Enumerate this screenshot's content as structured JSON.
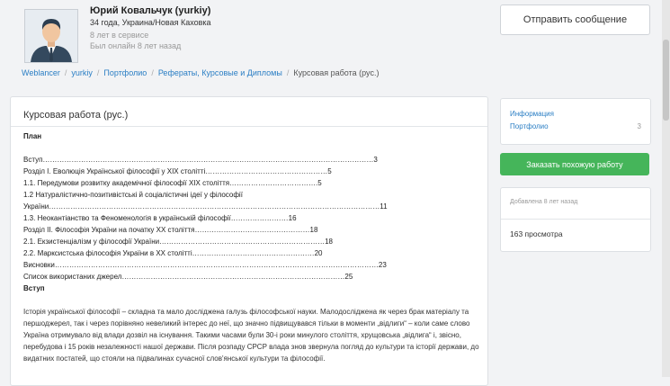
{
  "profile": {
    "name": "Юрий Ковальчук (yurkiy)",
    "info": "34 года, Украина/Новая Каховка",
    "service": "8 лет в сервисе",
    "online": "Был онлайн 8 лет назад"
  },
  "header": {
    "message_button": "Отправить сообщение"
  },
  "breadcrumb": {
    "items": [
      "Weblancer",
      "yurkiy",
      "Портфолио",
      "Рефераты, Курсовые и Дипломы"
    ],
    "current": "Курсовая работа (рус.)"
  },
  "main": {
    "title": "Курсовая работа (рус.)",
    "plan_heading": "План",
    "toc": [
      "Вступ…………………………………………………………………………………………………………………………3",
      "Розділ І. Еволюція Української філософії у ХІХ столітті……………………………………………5",
      "1.1. Передумови розвитку академічної філософії ХІХ століття……………………………….5",
      "1.2 Натуралістично-позитивістські й соціалістичні ідеї у філософії",
      "України…………………………………………………………………………………………………………………………11",
      "1.3. Неокантіанство та Феноменологія в українській філософії……………………16",
      "Розділ ІІ. Філософія України на початку ХХ століття…………………………………………18",
      "2.1. Екзистенціалізм у філософії України……………………………………………………………18",
      "2.2. Марксистська філософія України в ХХ столітті……………………………………………20",
      "Висновки………………………………………………………………………………………………………………………23",
      "Список використаних джерел…………………………………………………………………………………25"
    ],
    "intro_heading": "Вступ",
    "paragraph": "Історія української філософії – складна та мало досліджена галузь філософської науки. Малодосліджена як через брак матеріалу та першоджерел, так і через порівняно невеликий інтерес до неї, що значно підвищувався тільки в моменти „відлиги“ – коли саме слово Україна отримувало від влади дозвіл на існування. Такими часами були 30-і роки минулого століття, хрущовська „відлига“ і, звісно, перебудова і 15 років незалежності нашої держави. Після розпаду СРСР влада знов звернула погляд до культури та історії держави, до видатних постатей, що стояли на підвалинах сучасної слов'янської культури та філософії."
  },
  "sidebar": {
    "info_link": "Информация",
    "portfolio_link": "Портфолио",
    "portfolio_count": "3",
    "order_button": "Заказать похожую работу",
    "added": "Добавлена 8 лет назад",
    "views": "163 просмотра"
  },
  "colors": {
    "link": "#2a7ec4",
    "order_button": "#45b55a",
    "background": "#f2f3f5"
  }
}
